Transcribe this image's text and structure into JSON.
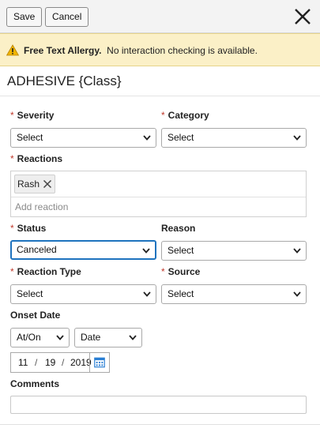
{
  "toolbar": {
    "save_label": "Save",
    "cancel_label": "Cancel"
  },
  "alert": {
    "title": "Free Text Allergy.",
    "message": "No interaction checking is available."
  },
  "allergy": {
    "name": "ADHESIVE {Class}"
  },
  "form": {
    "severity": {
      "label": "Severity",
      "value": "Select"
    },
    "category": {
      "label": "Category",
      "value": "Select"
    },
    "reactions": {
      "label": "Reactions",
      "items": [
        "Rash"
      ],
      "placeholder": "Add reaction"
    },
    "status": {
      "label": "Status",
      "value": "Canceled"
    },
    "reason": {
      "label": "Reason",
      "value": "Select"
    },
    "reaction_type": {
      "label": "Reaction Type",
      "value": "Select"
    },
    "source": {
      "label": "Source",
      "value": "Select"
    },
    "onset": {
      "label": "Onset Date",
      "qualifier": "At/On",
      "precision": "Date",
      "month": "11",
      "day": "19",
      "year": "2019"
    },
    "comments": {
      "label": "Comments",
      "value": ""
    }
  },
  "required_marker": "*",
  "date_separator": "/",
  "icons": [
    "warning-icon",
    "close-icon",
    "remove-chip-icon",
    "chevron-down-icon",
    "calendar-icon"
  ],
  "colors": {
    "alert_bg": "#fbf0c7",
    "required": "#c0392b",
    "focus": "#1e73be"
  }
}
